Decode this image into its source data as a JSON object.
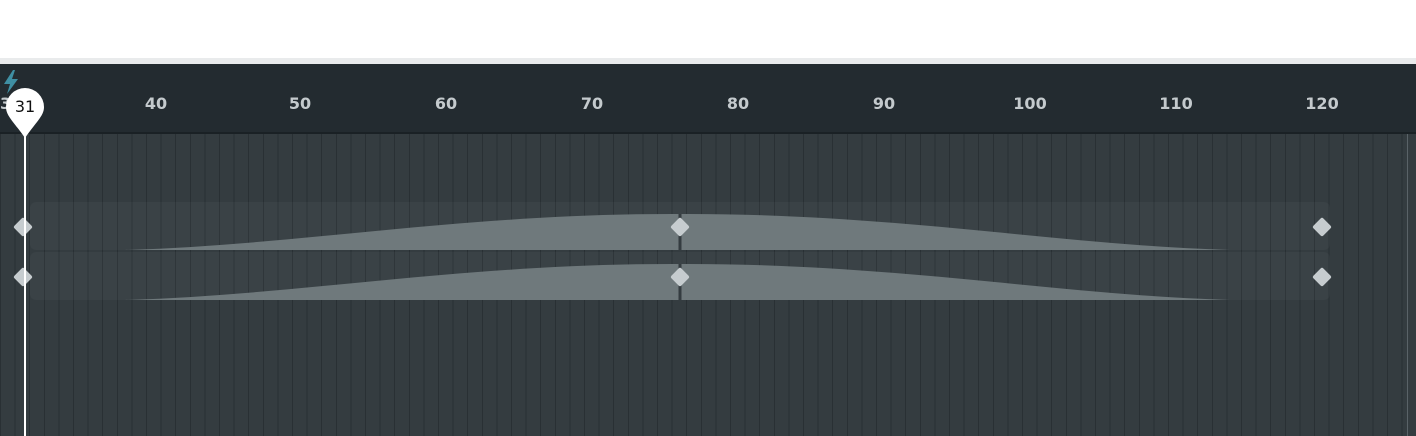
{
  "ruler": {
    "edge_label": "3",
    "ticks": [
      "40",
      "50",
      "60",
      "70",
      "80",
      "90",
      "100",
      "110",
      "120"
    ]
  },
  "playhead": {
    "value": "31"
  },
  "icons": {
    "ruler": "lightning-bolt-icon",
    "keyframe": "diamond-keyframe-icon"
  },
  "colors": {
    "ruler_background": "#232b30",
    "track_background": "#343c40",
    "tick_text": "#c4cacd",
    "curve_fill": "#6f797c",
    "keyframe": "#c6cccf",
    "playhead": "#ffffff",
    "bolt": "#3f8fa3"
  }
}
